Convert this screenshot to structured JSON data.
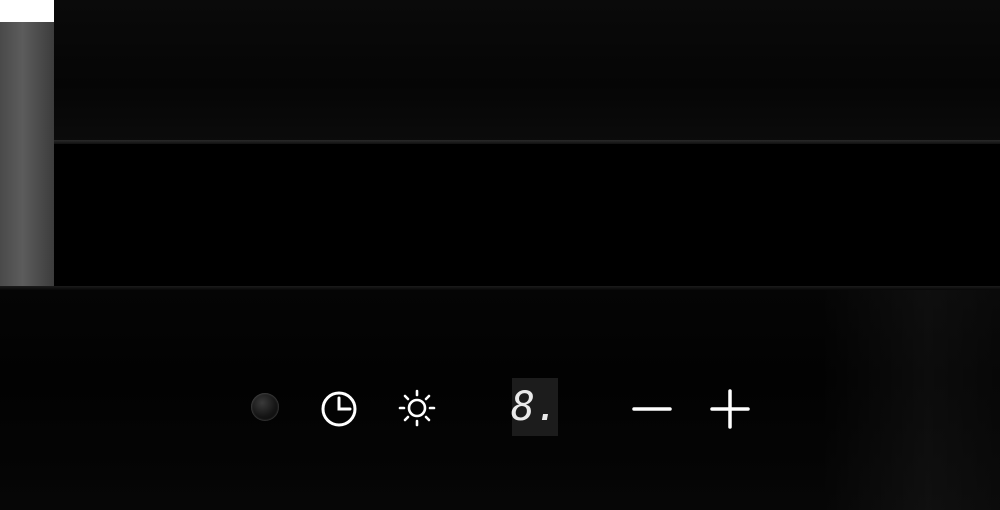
{
  "device": {
    "name": "kitchen-hood-control-panel",
    "controls": {
      "power": {
        "icon": "power-button-icon"
      },
      "timer": {
        "icon": "timer-clock-icon"
      },
      "light": {
        "icon": "light-sun-icon"
      },
      "display": {
        "value": "8."
      },
      "decrease": {
        "icon": "minus-icon"
      },
      "increase": {
        "icon": "plus-icon"
      }
    },
    "colors": {
      "glass": "#030303",
      "icon": "#ffffff",
      "display_bg": "#1c1c1c",
      "display_text": "#e9e9e9",
      "side_panel": "#4e4e4e"
    }
  }
}
